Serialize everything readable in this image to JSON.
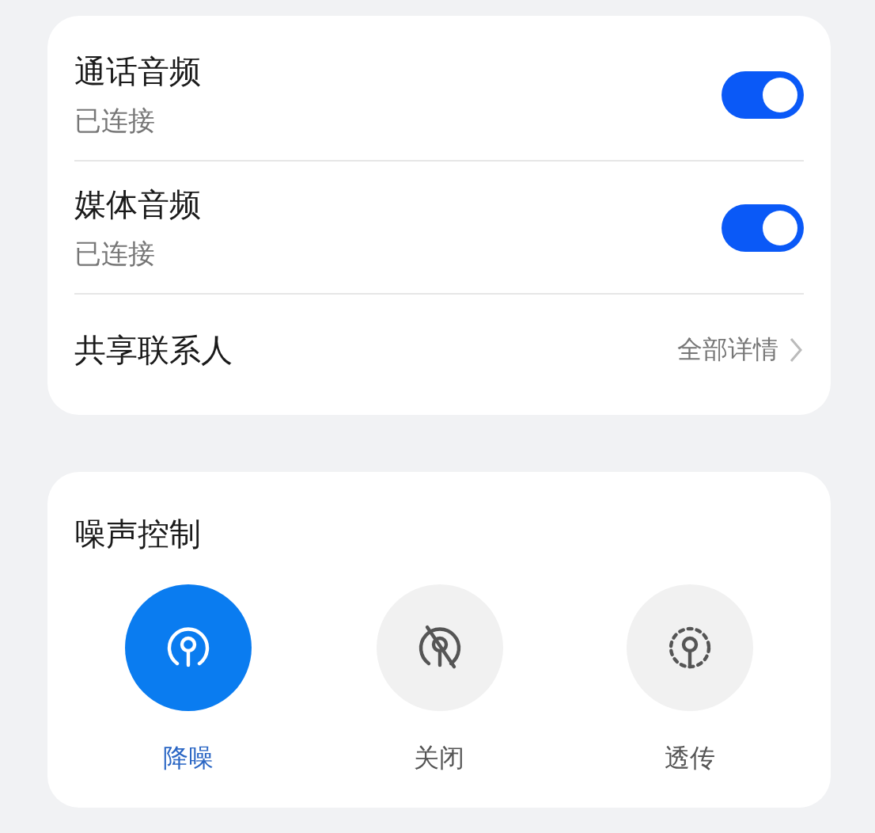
{
  "audio_rows": [
    {
      "kind": "toggle",
      "title": "通话音频",
      "subtitle": "已连接",
      "on": true
    },
    {
      "kind": "toggle",
      "title": "媒体音频",
      "subtitle": "已连接",
      "on": true
    },
    {
      "kind": "link",
      "title": "共享联系人",
      "value": "全部详情"
    }
  ],
  "noise_control": {
    "title": "噪声控制",
    "modes": [
      {
        "kind": "anc",
        "label": "降噪",
        "selected": true
      },
      {
        "kind": "off",
        "label": "关闭",
        "selected": false
      },
      {
        "kind": "transparency",
        "label": "透传",
        "selected": false
      }
    ]
  }
}
